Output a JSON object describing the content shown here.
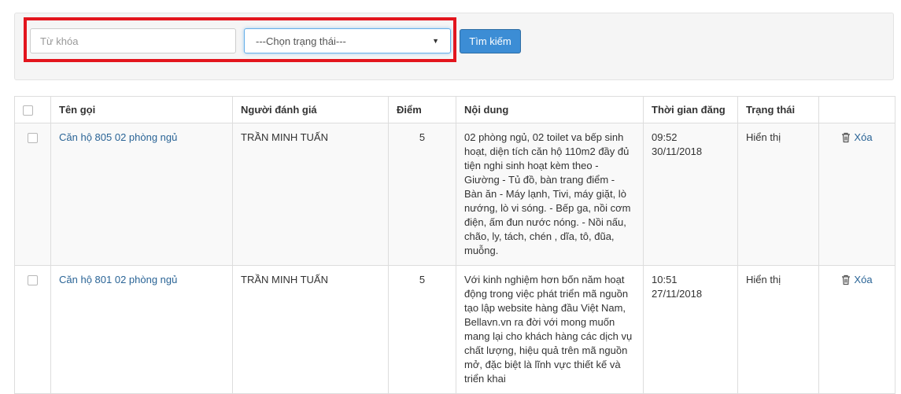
{
  "filter": {
    "keyword_placeholder": "Từ khóa",
    "keyword_value": "",
    "status_selected": "---Chọn trạng thái---",
    "search_label": "Tìm kiếm"
  },
  "table": {
    "headers": {
      "name": "Tên gọi",
      "reviewer": "Người đánh giá",
      "score": "Điểm",
      "content": "Nội dung",
      "posted_time": "Thời gian đăng",
      "status": "Trạng thái"
    },
    "rows": [
      {
        "name": "Căn hộ 805 02 phòng ngủ",
        "reviewer": "TRẦN MINH TUẤN",
        "score": "5",
        "content": "02 phòng ngủ, 02 toilet va bếp sinh hoạt, diện tích căn hộ 110m2 đầy đủ tiện nghi sinh hoạt kèm theo - Giường - Tủ đồ, bàn trang điểm - Bàn ăn - Máy lạnh, Tivi, máy giặt, lò nướng, lò vi sóng. - Bếp ga, nồi cơm điện, ấm đun nước nóng. - Nồi nấu, chão, ly, tách, chén , dĩa, tô, đũa, muỗng.",
        "posted_time": "09:52 30/11/2018",
        "status": "Hiển thị",
        "action": "Xóa"
      },
      {
        "name": "Căn hộ 801 02 phòng ngủ",
        "reviewer": "TRẦN MINH TUẤN",
        "score": "5",
        "content": "Với kinh nghiệm hơn bốn năm hoạt động trong việc phát triển mã nguồn tạo lập website hàng đầu Việt Nam, Bellavn.vn ra đời với mong muốn mang lại cho khách hàng các dịch vụ chất lượng, hiệu quả trên mã nguồn mở, đặc biệt là lĩnh vực thiết kế và triển khai",
        "posted_time": "10:51 27/11/2018",
        "status": "Hiển thị",
        "action": "Xóa"
      }
    ]
  },
  "colors": {
    "highlight": "#e3151d",
    "primary_button": "#3c8dd5",
    "link": "#2a6496"
  },
  "icons": {
    "dropdown": "caret-down-icon",
    "delete": "trash-icon"
  }
}
